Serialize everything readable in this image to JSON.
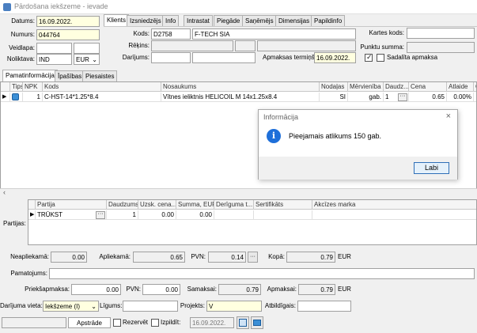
{
  "window": {
    "title": "Pārdošana iekšzeme - ievade"
  },
  "left_fields": {
    "datums_label": "Datums:",
    "datums_value": "16.09.2022.",
    "numurs_label": "Numurs:",
    "numurs_value": "044764",
    "veidlapa_label": "Veidlapa:",
    "veidlapa_value": "",
    "noliktava_label": "Noliktava:",
    "noliktava_value": "IND",
    "currency": "EUR"
  },
  "top_tabs": [
    "Klients",
    "Izsniedzējs",
    "Info",
    "Intrastat",
    "Piegāde",
    "Saņēmējs",
    "Dimensijas",
    "Papildinfo"
  ],
  "client": {
    "kods_label": "Kods:",
    "kods_value": "D2758",
    "name_value": "F-TECH SIA",
    "rekins_label": "Rēķins:",
    "darijums_label": "Darījums:",
    "apmaksas_label": "Apmaksas termiņš:",
    "apmaksas_value": "16.09.2022.",
    "kartes_label": "Kartes kods:",
    "kartes_value": "",
    "punktu_label": "Punktu summa:",
    "punktu_value": "",
    "sadalita_label": "Sadalīta apmaksa"
  },
  "mid_tabs": [
    "Pamatinformācija",
    "Īpašības",
    "Piesaistes"
  ],
  "item_grid": {
    "headers": [
      "Tips",
      "NPK",
      "Kods",
      "Nosaukums",
      "Nodaļas",
      "Mērvienība",
      "Daudz...",
      "Cena",
      "Atlaide",
      "C"
    ],
    "row": {
      "npk": "1",
      "kods": "C-HST-14*1.25*8.4",
      "nosaukums": "Vītnes ieliktnis HELICOIL M 14x1.25x8.4",
      "nodalas": "SI",
      "merv": "gab.",
      "daudz": "1",
      "cena": "0.65",
      "atlaide": "0.00%"
    }
  },
  "dialog": {
    "title": "Informācija",
    "close": "×",
    "message": "Pieejamais atlikums 150 gab.",
    "ok_label": "Labi"
  },
  "partijas": {
    "label": "Partijas:",
    "headers": [
      "Partija",
      "Daudzums",
      "Uzsk. cena...",
      "Summa, EUR",
      "Derīguma t...",
      "Sertifikāts",
      "Akcīzes marka"
    ],
    "row": {
      "partija": "TRŪKST",
      "daudzums": "1",
      "cena": "0.00",
      "summa": "0.00"
    }
  },
  "totals": {
    "neapliekama_label": "Neapliekamā:",
    "neapliekama_value": "0.00",
    "apliekama_label": "Apliekamā:",
    "apliekama_value": "0.65",
    "pvn_label": "PVN:",
    "pvn_value": "0.14",
    "kopa_label": "Kopā:",
    "kopa_value": "0.79",
    "currency": "EUR",
    "pamatojums_label": "Pamatojums:",
    "pamatojums_value": "",
    "priekssapmaksa_label": "Priekšapmaksa:",
    "priekssapmaksa_value": "0.00",
    "pvn2_label": "PVN:",
    "pvn2_value": "0.00",
    "samaksai_label": "Samaksai:",
    "samaksai_value": "0.79",
    "apmaksai_label": "Apmaksai:",
    "apmaksai_value": "0.79",
    "currency2": "EUR"
  },
  "bottom": {
    "darijuma_label": "Darījuma vieta:",
    "darijuma_value": "Iekšzeme (I)",
    "ligums_label": "Līgums:",
    "ligums_value": "",
    "projekts_label": "Projekts:",
    "projekts_value": "V",
    "atbildigais_label": "Atbildīgais:",
    "atbildigais_value": "",
    "status_value": "",
    "apstrade_label": "Apstrāde",
    "rezervet_label": "Rezervēt",
    "izpildit_label": "Izpildīt:",
    "izpildit_value": "16.09.2022."
  },
  "colors": {
    "accent": "#1e6fd9",
    "yellow_field": "#ffffe0"
  }
}
